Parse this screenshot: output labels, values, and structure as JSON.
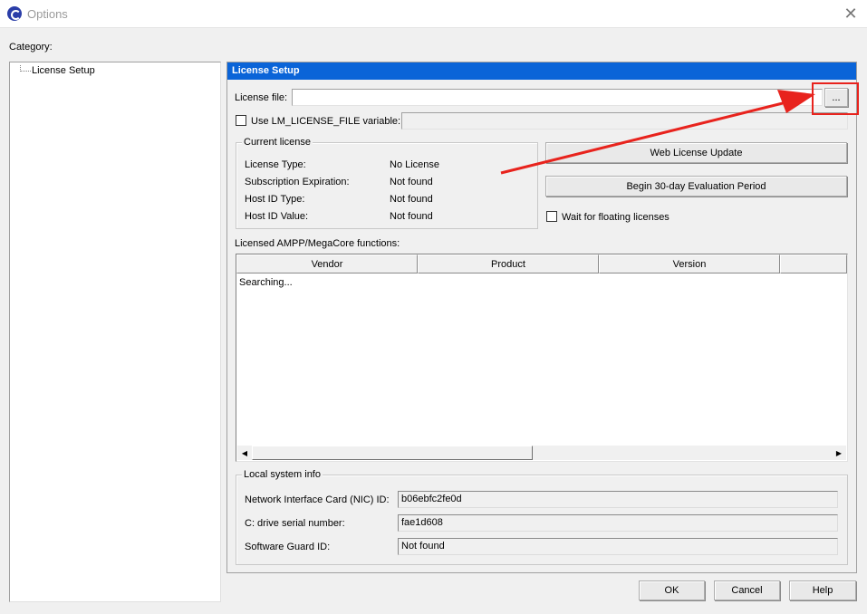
{
  "window": {
    "title": "Options",
    "close_glyph": "✕",
    "icon": "quartus-app-icon"
  },
  "sidebar": {
    "category_label": "Category:",
    "items": [
      {
        "label": "License Setup"
      }
    ]
  },
  "panel": {
    "header": "License Setup",
    "license_file": {
      "label": "License file:",
      "value": "",
      "browse_label": "..."
    },
    "use_env": {
      "label": "Use LM_LICENSE_FILE variable:",
      "checked": false,
      "value": ""
    },
    "current_license": {
      "title": "Current license",
      "rows": [
        {
          "key": "License Type:",
          "value": "No License"
        },
        {
          "key": "Subscription Expiration:",
          "value": "Not found"
        },
        {
          "key": "Host ID Type:",
          "value": "Not found"
        },
        {
          "key": "Host ID Value:",
          "value": "Not found"
        }
      ]
    },
    "buttons": {
      "web_update": "Web License Update",
      "evaluation": "Begin 30-day Evaluation Period"
    },
    "floating": {
      "label": "Wait for floating licenses",
      "checked": false
    },
    "functions": {
      "label": "Licensed AMPP/MegaCore functions:",
      "columns": [
        "Vendor",
        "Product",
        "Version"
      ],
      "status_text": "Searching...",
      "scroll_left": "◀",
      "scroll_right": "▶"
    },
    "local_info": {
      "title": "Local system info",
      "rows": [
        {
          "key": "Network Interface Card (NIC) ID:",
          "value": "b06ebfc2fe0d"
        },
        {
          "key": "C: drive serial number:",
          "value": "fae1d608"
        },
        {
          "key": "Software Guard ID:",
          "value": "Not found"
        }
      ]
    }
  },
  "footer": {
    "ok": "OK",
    "cancel": "Cancel",
    "help": "Help"
  },
  "annotation": {
    "color": "#e8231d"
  },
  "colors": {
    "header_bg": "#0a64d8",
    "window_bg": "#f0f0f0"
  }
}
